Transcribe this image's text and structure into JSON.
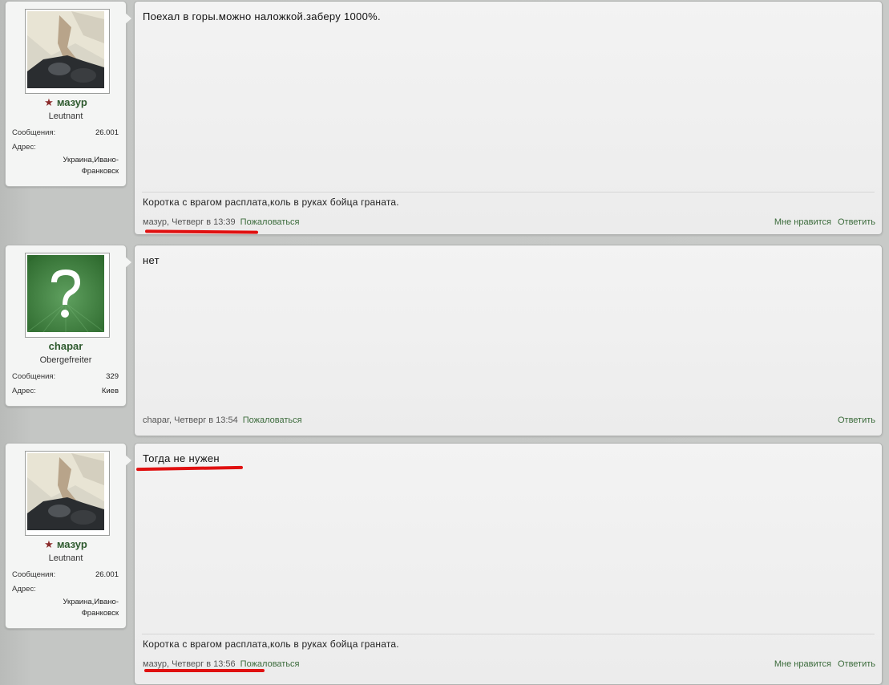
{
  "labels": {
    "messages": "Сообщения:",
    "address": "Адрес:",
    "like": "Мне нравится",
    "reply": "Ответить",
    "report": "Пожаловаться"
  },
  "posts": [
    {
      "user": {
        "name": "мазур",
        "rank": "Leutnant",
        "messages": "26.001",
        "address_line1": "Украина,Ивано-",
        "address_line2": "Франковск",
        "avatar": "photo-avatar"
      },
      "text": "Поехал в горы.можно наложкой.заберу 1000%.",
      "signature": "Коротка с врагом расплата,коль в руках бойца граната.",
      "meta": "мазур, Четверг в 13:39"
    },
    {
      "user": {
        "name": "chapar",
        "rank": "Obergefreiter",
        "messages": "329",
        "address_line1": "Киев",
        "avatar": "question-mark-avatar"
      },
      "text": "нет",
      "meta": "chapar, Четверг в 13:54"
    },
    {
      "user": {
        "name": "мазур",
        "rank": "Leutnant",
        "messages": "26.001",
        "address_line1": "Украина,Ивано-",
        "address_line2": "Франковск",
        "avatar": "photo-avatar"
      },
      "text": "Тогда не нужен",
      "signature": "Коротка с врагом расплата,коль в руках бойца граната.",
      "meta": "мазур, Четверг в 13:56"
    }
  ],
  "colors": {
    "annotation_red": "#e01010",
    "link_green": "#3b6b3b",
    "username_green": "#2e5a2e"
  }
}
